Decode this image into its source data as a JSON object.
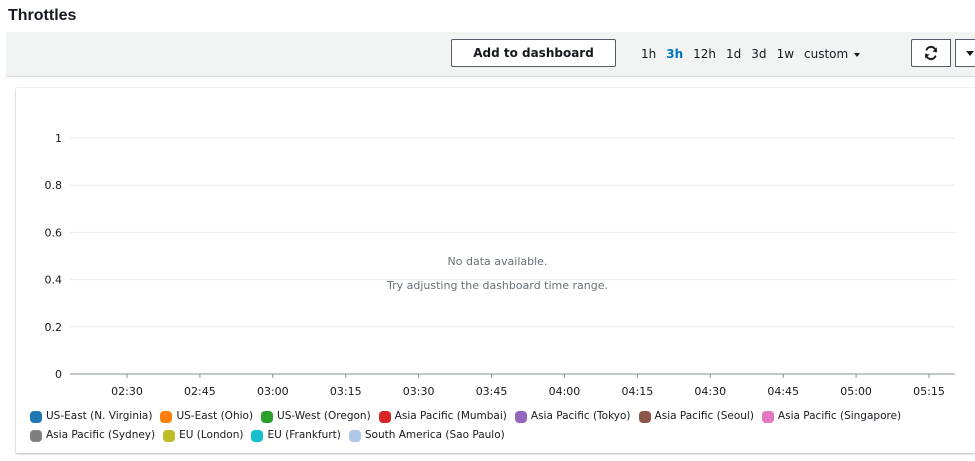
{
  "widget": {
    "title": "Throttles"
  },
  "toolbar": {
    "add_to_dashboard_label": "Add to dashboard",
    "time_ranges": [
      "1h",
      "3h",
      "12h",
      "1d",
      "3d",
      "1w"
    ],
    "active_range": "3h",
    "custom_label": "custom",
    "refresh_icon": "refresh-icon",
    "dropdown_icon": "caret-down-icon"
  },
  "chart_data": {
    "type": "line",
    "title": "",
    "xlabel": "",
    "ylabel": "",
    "y_ticks": [
      "0",
      "0.2",
      "0.4",
      "0.6",
      "0.8",
      "1"
    ],
    "ylim": [
      0,
      1
    ],
    "x_ticks": [
      "02:30",
      "02:45",
      "03:00",
      "03:15",
      "03:30",
      "03:45",
      "04:00",
      "04:15",
      "04:30",
      "04:45",
      "05:00",
      "05:15"
    ],
    "grid": true,
    "series": [],
    "empty_message": "No data available.",
    "empty_hint": "Try adjusting the dashboard time range.",
    "legend_position": "bottom"
  },
  "legend": {
    "rows": [
      [
        {
          "label": "US-East (N. Virginia)",
          "color": "#1f77b4"
        },
        {
          "label": "US-East (Ohio)",
          "color": "#ff7f0e"
        },
        {
          "label": "US-West (Oregon)",
          "color": "#2ca02c"
        },
        {
          "label": "Asia Pacific (Mumbai)",
          "color": "#d62728"
        },
        {
          "label": "Asia Pacific (Tokyo)",
          "color": "#9467bd"
        },
        {
          "label": "Asia Pacific (Seoul)",
          "color": "#8c564b"
        },
        {
          "label": "Asia Pacific (Singapore)",
          "color": "#e377c2"
        }
      ],
      [
        {
          "label": "Asia Pacific (Sydney)",
          "color": "#7f7f7f"
        },
        {
          "label": "EU (London)",
          "color": "#bcbd22"
        },
        {
          "label": "EU (Frankfurt)",
          "color": "#17becf"
        },
        {
          "label": "South America (Sao Paulo)",
          "color": "#aec7e8"
        }
      ]
    ]
  },
  "colors": {
    "accent": "#0073bb",
    "toolbar_bg": "#f2f3f3",
    "grid": "#e9ebed",
    "axis_text": "#16191f",
    "muted_text": "#687078"
  }
}
